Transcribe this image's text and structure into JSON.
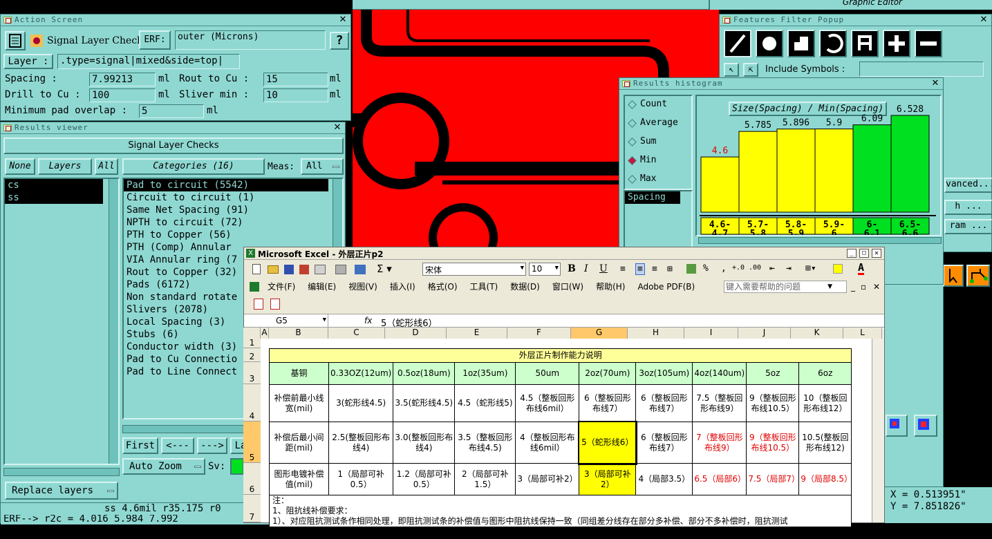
{
  "action_screen": {
    "title": "Action Screen",
    "checks_label": "Signal Layer Checks",
    "erf_label": "ERF:",
    "erf_value": "outer (Microns)",
    "help": "?",
    "layer_label": "Layer :",
    "layer_value": ".type=signal|mixed&side=top|",
    "spacing_label": "Spacing      :",
    "spacing_value": "7.99213",
    "unit": "ml",
    "rout_label": "Rout to Cu  :",
    "rout_value": "15",
    "drill_label": "Drill to Cu :",
    "drill_value": "100",
    "sliver_label": "Sliver min  :",
    "sliver_value": "10",
    "overlap_label": "Minimum pad overlap :",
    "overlap_value": "5"
  },
  "results_viewer": {
    "title": "Results viewer",
    "header": "Signal Layer Checks",
    "none": "None",
    "layers": "Layers",
    "all": "All",
    "categories": "Categories (16)",
    "meas_label": "Meas:",
    "meas_value": "All",
    "layer_items": [
      "cs",
      "ss"
    ],
    "category_items": [
      "Pad to circuit (5542)",
      "Circuit to circuit (1)",
      "Same Net Spacing (91)",
      "NPTH to circuit (72)",
      "PTH to Copper (56)",
      "PTH (Comp) Annular",
      "VIA Annular ring (7",
      "Rout to Copper (32)",
      "Pads (6172)",
      "Non standard rotate",
      "Slivers (2078)",
      "Local Spacing (3)",
      "Stubs (6)",
      "Conductor width (3)",
      "Pad to Cu Connectio",
      "Pad to Line Connect"
    ],
    "first": "First",
    "prev": "<---",
    "next": "--->",
    "last": "La",
    "auto_zoom": "Auto Zoom",
    "sv": "Sv:",
    "replace": "Replace layers",
    "status": "ss 4.6mil  r35.175  r0",
    "cmd": "ERF--> r2c = 4.016 5.984 7.992"
  },
  "graphic_editor": {
    "title": "Graphic Editor"
  },
  "features_filter": {
    "title": "Features Filter Popup",
    "include_symbols": "Include Symbols :",
    "advanced": "vanced...",
    "btn2": "h ...",
    "btn3": "ram ...",
    "coord_x": "X = 0.513951\"",
    "coord_y": "Y = 7.851826\""
  },
  "histogram": {
    "title": "Results histogram",
    "options": [
      "Count",
      "Average",
      "Sum",
      "Min",
      "Max"
    ],
    "selected": "Min",
    "list_item": "Spacing",
    "chart_title": "Size(Spacing) / Min(Spacing)"
  },
  "chart_data": {
    "type": "bar",
    "title": "Size(Spacing) / Min(Spacing)",
    "categories": [
      "4.6-4.7",
      "5.7-5.8",
      "5.8-5.9",
      "5.9-6",
      "6-6.1",
      "6.5-6.6"
    ],
    "values": [
      4.6,
      5.785,
      5.896,
      5.9,
      6.09,
      6.528
    ],
    "value_labels": [
      "4.6",
      "5.785",
      "5.896",
      "5.9",
      "6.09",
      "6.528"
    ],
    "colors": [
      "#ffff00",
      "#ffff00",
      "#ffff00",
      "#ffff00",
      "#00e020",
      "#00e020"
    ]
  },
  "excel": {
    "title": "Microsoft Excel - 外层正片p2",
    "font": "宋体",
    "size": "10",
    "menu": [
      "文件(F)",
      "编辑(E)",
      "视图(V)",
      "插入(I)",
      "格式(O)",
      "工具(T)",
      "数据(D)",
      "窗口(W)",
      "帮助(H)",
      "Adobe PDF(B)"
    ],
    "help_placeholder": "键入需要帮助的问题",
    "cell_ref": "G5",
    "fx": "fx",
    "formula": "5（蛇形线6）",
    "cols": [
      "A",
      "B",
      "C",
      "D",
      "E",
      "F",
      "G",
      "H",
      "I",
      "J",
      "K",
      "L"
    ],
    "rows": [
      "1",
      "2",
      "3",
      "4",
      "5",
      "6",
      "7"
    ],
    "table_title": "外层正片制作能力说明",
    "header": [
      "基铜",
      "0.33OZ(12um)",
      "0.5oz(18um)",
      "1oz(35um)",
      "50um",
      "2oz(70um)",
      "3oz(105um)",
      "4oz(140um)",
      "5oz",
      "6oz"
    ],
    "row4": [
      "补偿前最小线宽(mil)",
      "3(蛇形线4.5)",
      "3.5(蛇形线4.5)",
      "4.5（蛇形线5)",
      "4.5（整板回形布线6mil）",
      "6（整板回形布线7）",
      "6（整板回形布线7）",
      "7.5（整板回形布线9）",
      "9（整板回形布线10.5）",
      "10（整板回形布线12）"
    ],
    "row5": [
      "补偿后最小间距(mil)",
      "2.5(整板回形布线4)",
      "3.0(整板回形布线4)",
      "3.5（整板回形布线4.5)",
      "4（整板回形布线6mil）",
      "5（蛇形线6）",
      "6（整板回形布线7）",
      "7（整板回形布线9）",
      "9（整板回形布线10.5）",
      "10.5(整板回形布线12)"
    ],
    "row6": [
      "图形电镀补偿值(mil)",
      "1（局部可补0.5）",
      "1.2（局部可补0.5）",
      "2（局部可补1.5）",
      "3（局部可补2）",
      "3（局部可补2）",
      "4（局部3.5）",
      "6.5（局部6）",
      "7.5（局部7）",
      "9（局部8.5）"
    ],
    "note1": "注：",
    "note2": "1、阻抗线补偿要求：",
    "note3": "1）、对应阻抗测试条作相同处理，即阻抗测试条的补偿值与图形中阻抗线保持一致（同组差分线存在部分多补偿、部分不多补偿时，阻抗测试"
  }
}
